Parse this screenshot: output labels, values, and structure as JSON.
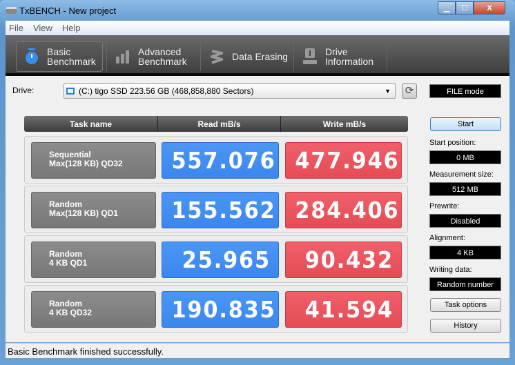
{
  "window": {
    "title": "TxBENCH - New project",
    "minimize": "▁",
    "maximize": "☐",
    "close": "X"
  },
  "menu": [
    "File",
    "View",
    "Help"
  ],
  "tabs": [
    {
      "label1": "Basic",
      "label2": "Benchmark",
      "icon": "stopwatch-icon"
    },
    {
      "label1": "Advanced",
      "label2": "Benchmark",
      "icon": "bar-chart-icon"
    },
    {
      "label1": "Data Erasing",
      "label2": "",
      "icon": "eraser-icon"
    },
    {
      "label1": "Drive",
      "label2": "Information",
      "icon": "drive-info-icon"
    }
  ],
  "drive": {
    "label": "Drive:",
    "value": "(C:) tigo SSD  223.56 GB (468,858,880 Sectors)",
    "mode": "FILE mode"
  },
  "table": {
    "headers": [
      "Task name",
      "Read mB/s",
      "Write mB/s"
    ],
    "rows": [
      {
        "task1": "Sequential",
        "task2": "Max(128 KB) QD32",
        "read": "557.076",
        "write": "477.946"
      },
      {
        "task1": "Random",
        "task2": "Max(128 KB) QD1",
        "read": "155.562",
        "write": "284.406"
      },
      {
        "task1": "Random",
        "task2": "4 KB QD1",
        "read": "25.965",
        "write": "90.432"
      },
      {
        "task1": "Random",
        "task2": "4 KB QD32",
        "read": "190.835",
        "write": "41.594"
      }
    ]
  },
  "settings": {
    "start": "Start",
    "start_position_label": "Start position:",
    "start_position": "0 MB",
    "measurement_size_label": "Measurement size:",
    "measurement_size": "512 MB",
    "prewrite_label": "Prewrite:",
    "prewrite": "Disabled",
    "alignment_label": "Alignment:",
    "alignment": "4 KB",
    "writing_data_label": "Writing data:",
    "writing_data": "Random number",
    "task_options": "Task options",
    "history": "History"
  },
  "status": "Basic Benchmark finished successfully.",
  "colors": {
    "read": "#3b86ee",
    "write": "#e54b55",
    "task": "#808080"
  }
}
